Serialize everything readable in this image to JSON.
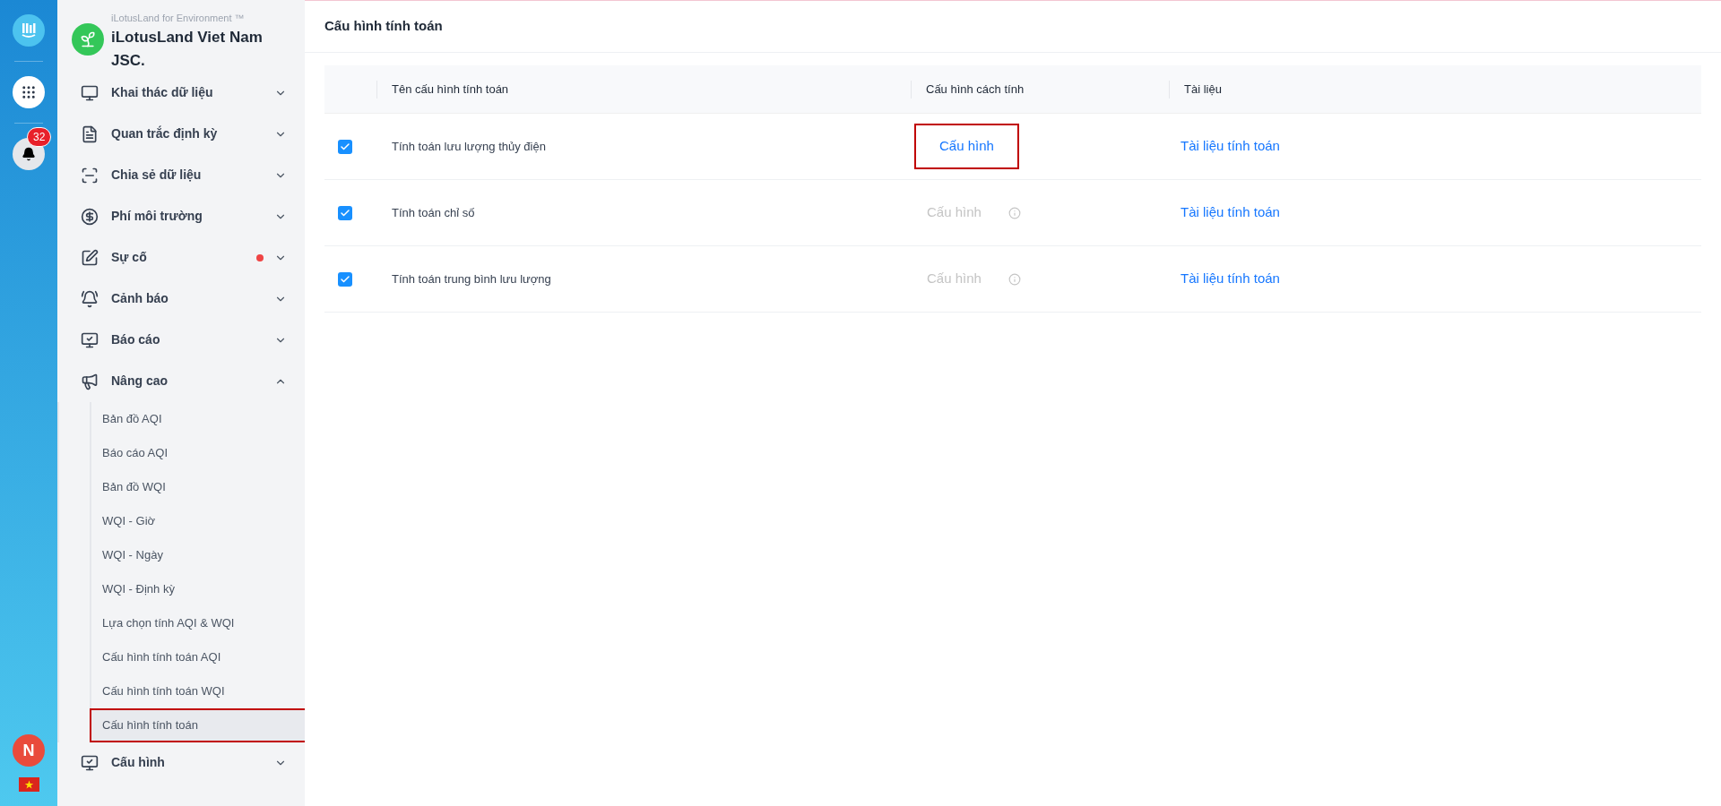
{
  "rail": {
    "notification_count": "32",
    "avatar_initial": "N"
  },
  "brand": {
    "tagline": "iLotusLand for Environment ™",
    "name": "iLotusLand Viet Nam JSC."
  },
  "sidebar": {
    "items": [
      {
        "label": "Khai thác dữ liệu",
        "expanded": false,
        "dot": false
      },
      {
        "label": "Quan trắc định kỳ",
        "expanded": false,
        "dot": false
      },
      {
        "label": "Chia sẻ dữ liệu",
        "expanded": false,
        "dot": false
      },
      {
        "label": "Phí môi trường",
        "expanded": false,
        "dot": false
      },
      {
        "label": "Sự cố",
        "expanded": false,
        "dot": true
      },
      {
        "label": "Cảnh báo",
        "expanded": false,
        "dot": false
      },
      {
        "label": "Báo cáo",
        "expanded": false,
        "dot": false
      },
      {
        "label": "Nâng cao",
        "expanded": true,
        "dot": false,
        "children": [
          {
            "label": "Bản đồ AQI",
            "selected": false
          },
          {
            "label": "Báo cáo AQI",
            "selected": false
          },
          {
            "label": "Bản đồ WQI",
            "selected": false
          },
          {
            "label": "WQI - Giờ",
            "selected": false
          },
          {
            "label": "WQI - Ngày",
            "selected": false
          },
          {
            "label": "WQI - Định kỳ",
            "selected": false
          },
          {
            "label": "Lựa chọn tính AQI & WQI",
            "selected": false
          },
          {
            "label": "Cấu hình tính toán AQI",
            "selected": false
          },
          {
            "label": "Cấu hình tính toán WQI",
            "selected": false
          },
          {
            "label": "Cấu hình tính toán",
            "selected": true
          }
        ]
      },
      {
        "label": "Cấu hình",
        "expanded": false,
        "dot": false
      }
    ]
  },
  "page": {
    "title": "Cấu hình tính toán"
  },
  "table": {
    "columns": [
      "Tên cấu hình tính toán",
      "Cấu hình cách tính",
      "Tài liệu"
    ],
    "rows": [
      {
        "checked": true,
        "name": "Tính toán lưu lượng thủy điện",
        "config": "Cấu hình",
        "config_disabled": false,
        "highlighted": true,
        "doc": "Tài liệu tính toán"
      },
      {
        "checked": true,
        "name": "Tính toán chỉ số",
        "config": "Cấu hình",
        "config_disabled": true,
        "highlighted": false,
        "doc": "Tài liệu tính toán"
      },
      {
        "checked": true,
        "name": "Tính toán trung bình lưu lượng",
        "config": "Cấu hình",
        "config_disabled": true,
        "highlighted": false,
        "doc": "Tài liệu tính toán"
      }
    ]
  }
}
